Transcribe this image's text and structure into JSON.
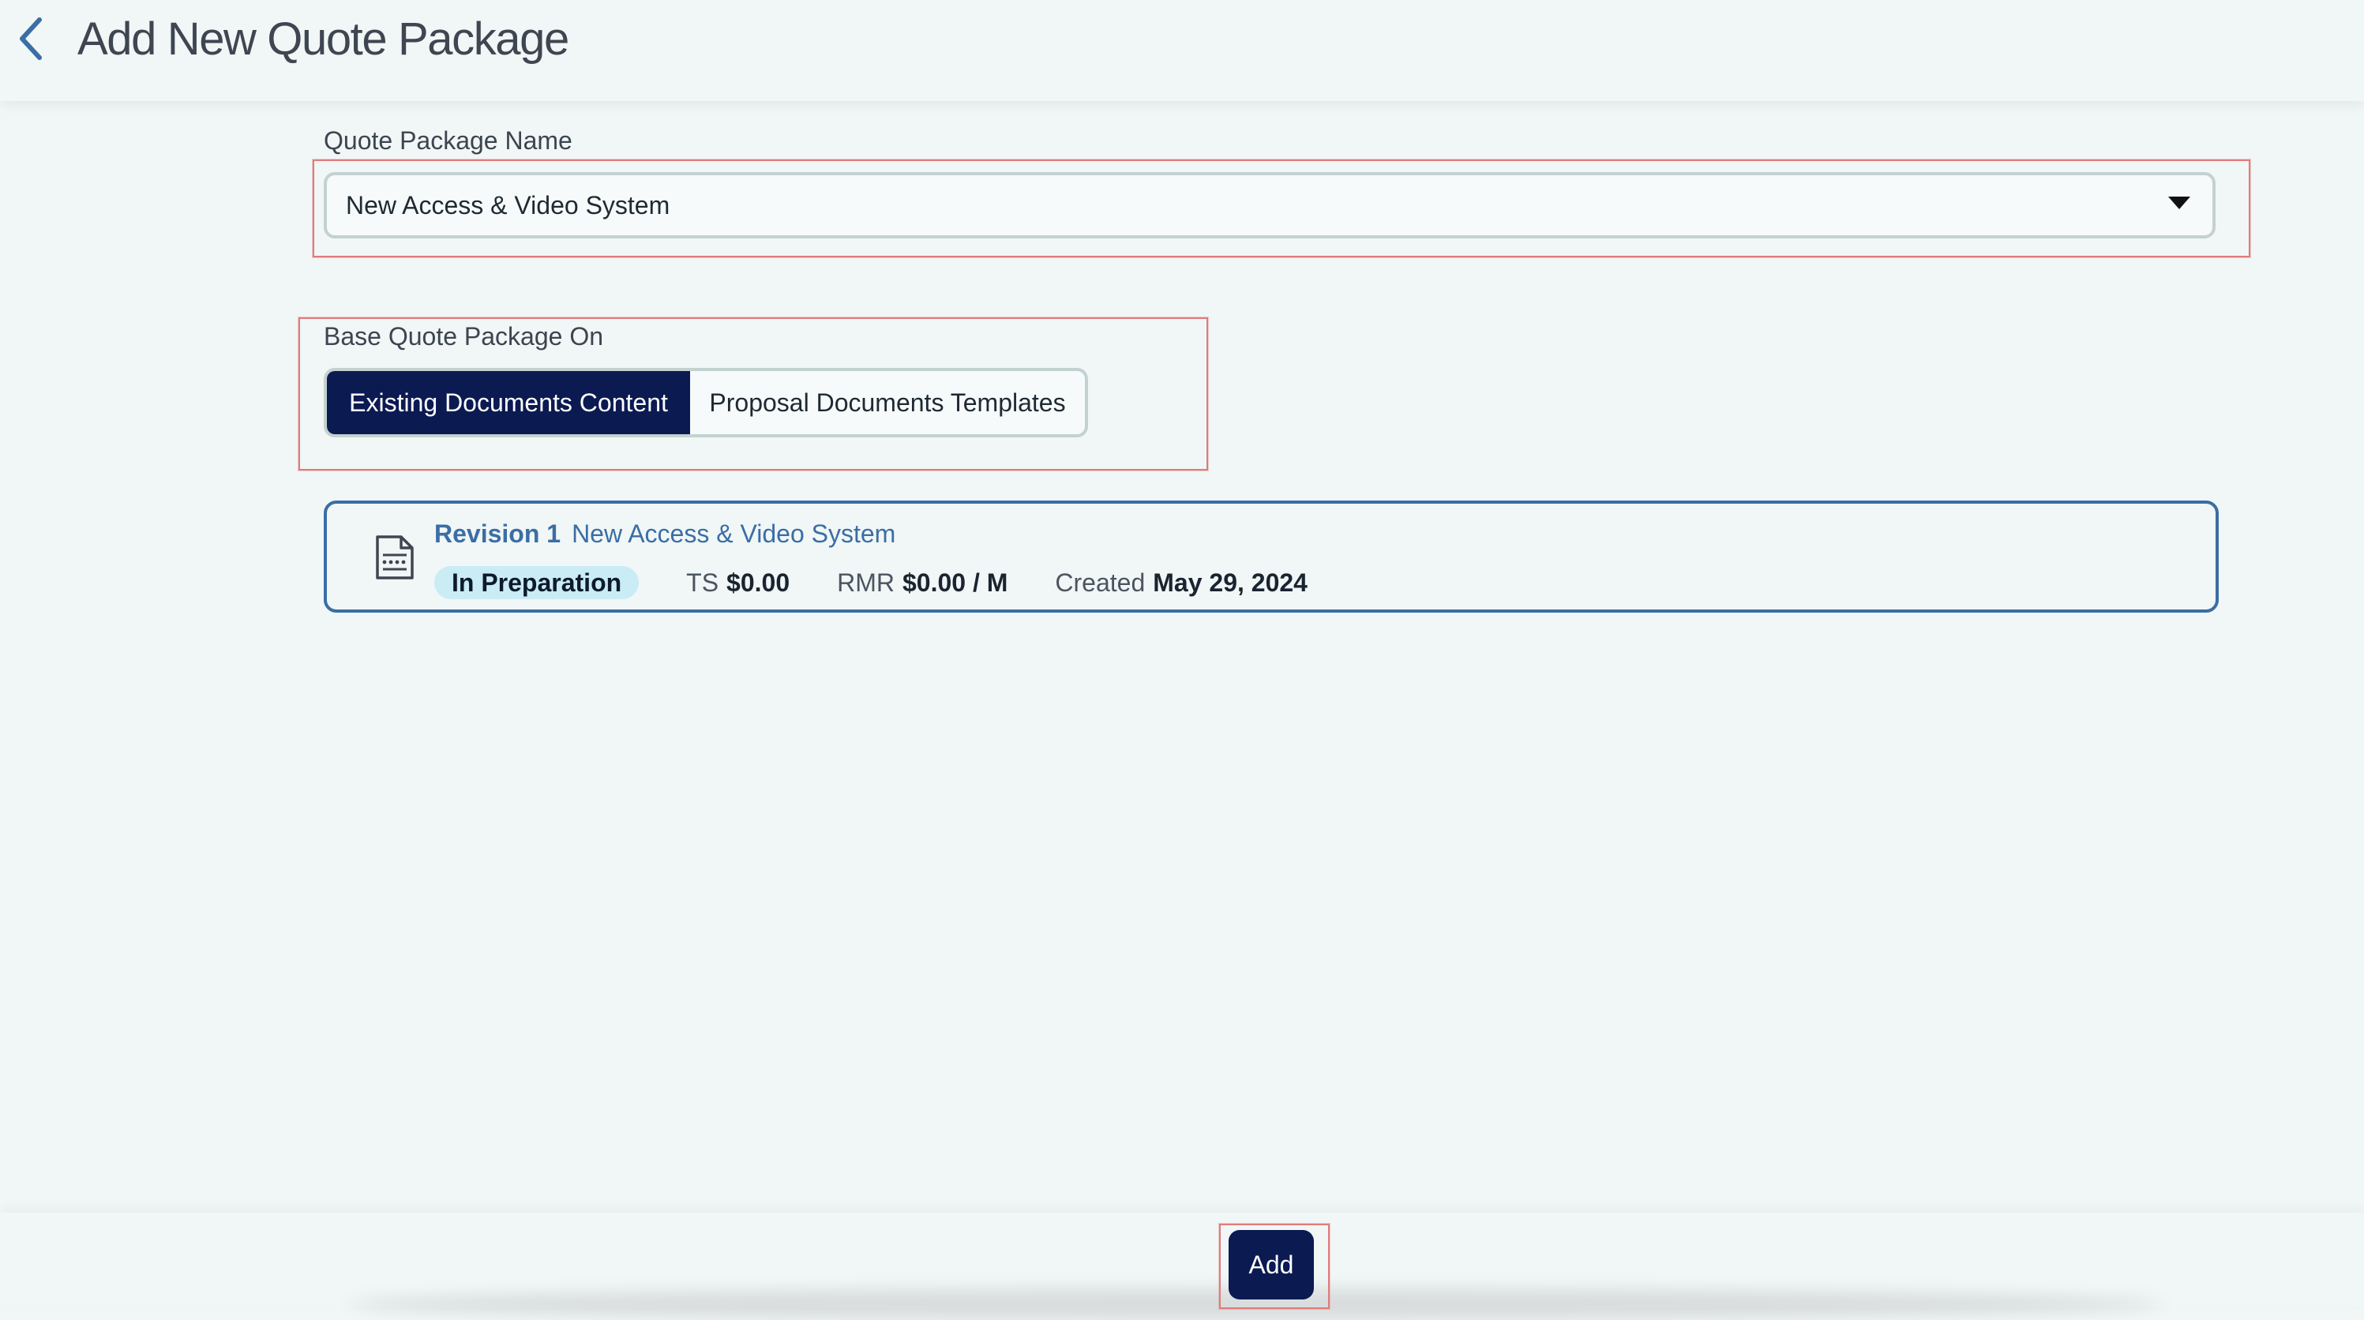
{
  "header": {
    "title": "Add New Quote Package"
  },
  "quote_package_name": {
    "label": "Quote Package Name",
    "selected_value": "New Access & Video System"
  },
  "base_on": {
    "label": "Base Quote Package On",
    "options": [
      {
        "label": "Existing Documents Content",
        "active": true
      },
      {
        "label": "Proposal Documents Templates",
        "active": false
      }
    ]
  },
  "revision": {
    "label": "Revision 1",
    "name": "New Access & Video System",
    "status": "In Preparation",
    "ts_label": "TS",
    "ts_value": "$0.00",
    "rmr_label": "RMR",
    "rmr_value": "$0.00 / M",
    "created_label": "Created",
    "created_value": "May 29, 2024"
  },
  "footer": {
    "add_label": "Add"
  },
  "colors": {
    "background": "#f1f6f6",
    "primary": "#0c1a52",
    "accent": "#3a6ea5",
    "badge": "#c9ecf5",
    "highlight": "#e07b7b"
  },
  "icons": {
    "back": "chevron-left-icon",
    "caret": "caret-down-icon",
    "document": "document-icon"
  }
}
